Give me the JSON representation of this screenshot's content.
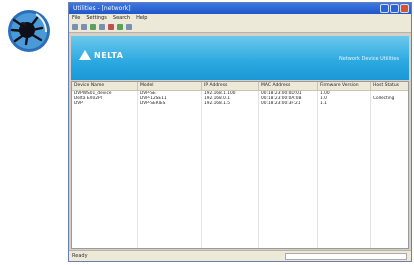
{
  "window": {
    "title": "Utilities - [network]"
  },
  "menu": [
    "File",
    "Settings",
    "Search",
    "Help"
  ],
  "banner": {
    "brand": "NELTA",
    "tagline": "Network Device Utilities"
  },
  "table": {
    "columns": [
      "Device Name",
      "Model",
      "IP Address",
      "MAC Address",
      "Firmware Version",
      "Host Status"
    ],
    "rows": [
      [
        "DVPWS01_device",
        "DVP-SE",
        "192.168.1.100",
        "00:18:23:00:0D:01",
        "1.00",
        ""
      ],
      [
        "Delta EX02PT",
        "DVP-12SE11",
        "192.168.0.1",
        "00:18:23:00:0A:0B",
        "1.0",
        "Collecting"
      ],
      [
        "DVP",
        "DVP-SERIES",
        "192.168.1.5",
        "00:18:23:00:3F:21",
        "1.1",
        ""
      ]
    ]
  },
  "status": {
    "text": "Ready"
  }
}
